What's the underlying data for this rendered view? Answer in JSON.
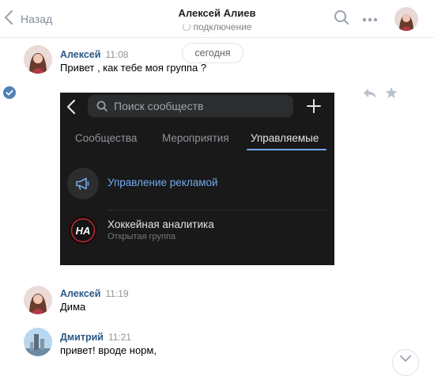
{
  "header": {
    "back_label": "Назад",
    "title": "Алексей Алиев",
    "status": "подключение"
  },
  "date_separator": "сегодня",
  "messages": [
    {
      "author": "Алексей",
      "time": "11:08",
      "text": "Привет , как тебе моя группа ?"
    },
    {
      "author": "Алексей",
      "time": "11:19",
      "text": "Дима"
    },
    {
      "author": "Дмитрий",
      "time": "11:21",
      "text": "привет! вроде норм,"
    }
  ],
  "attachment": {
    "search_placeholder": "Поиск сообществ",
    "tabs": [
      "Сообщества",
      "Мероприятия",
      "Управляемые"
    ],
    "active_tab": "Управляемые",
    "ad_management_label": "Управление рекламой",
    "group_name": "Хоккейная аналитика",
    "group_type": "Открытая группа",
    "group_logo_text": "HA"
  },
  "colors": {
    "link": "#2a5885",
    "accent_blue": "#71aaeb",
    "dark_bg": "#19191a",
    "check_badge": "#5181b8"
  },
  "icons": {
    "back": "chevron-left-icon",
    "search": "search-icon",
    "more": "more-dots-icon",
    "reply": "reply-icon",
    "favorite": "star-icon",
    "selected": "check-circle-icon",
    "scroll_down": "chevron-down-icon"
  }
}
